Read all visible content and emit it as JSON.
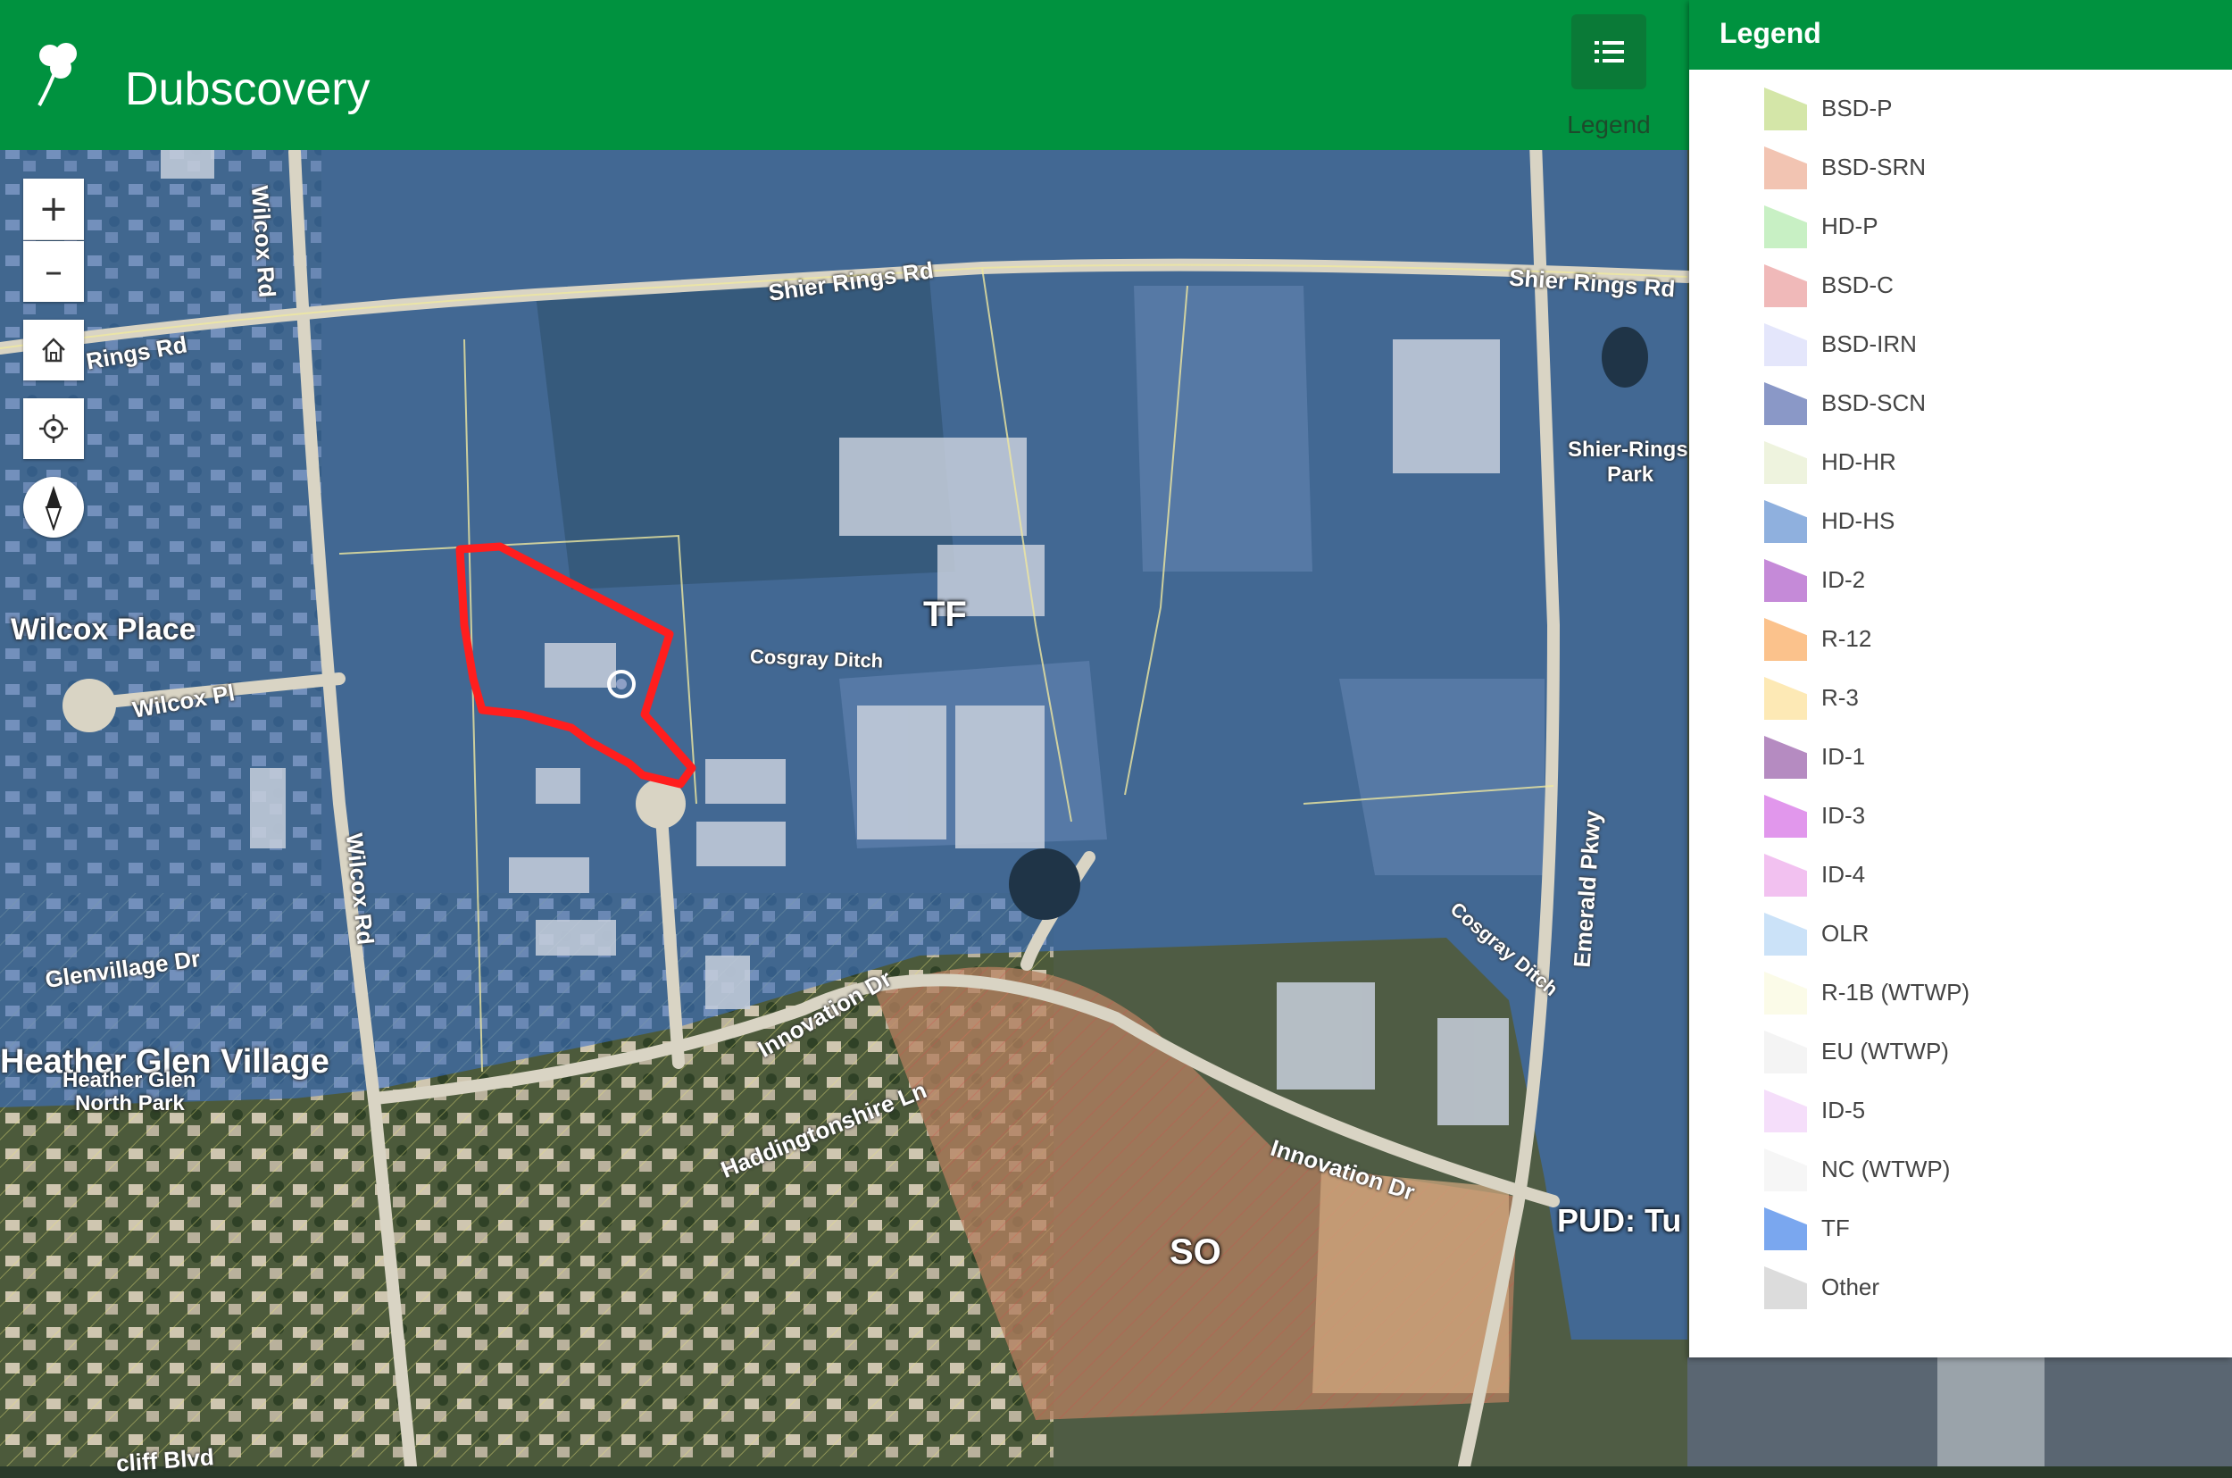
{
  "app": {
    "title": "Dubscovery"
  },
  "header": {
    "legend_button_label": "Legend"
  },
  "map_controls": {
    "zoom_in": "+",
    "zoom_out": "–"
  },
  "map_labels": {
    "roads": {
      "shier_rings_rd_1": "Shier Rings Rd",
      "shier_rings_rd_2": "Shier Rings Rd",
      "rings_rd": "Rings Rd",
      "wilcox_rd_north": "Wilcox Rd",
      "wilcox_rd_south": "Wilcox Rd",
      "wilcox_pl": "Wilcox Pl",
      "emerald_pkwy": "Emerald Pkwy",
      "innovation_dr_1": "Innovation Dr",
      "innovation_dr_2": "Innovation Dr",
      "cosgray_ditch_1": "Cosgray Ditch",
      "cosgray_ditch_2": "Cosgray Ditch",
      "glenvillage_dr": "Glenvillage Dr",
      "haddingtonshire_ln": "Haddingtonshire Ln",
      "cliff_blvd": "cliff Blvd"
    },
    "places": {
      "wilcox_place": "Wilcox Place",
      "heather_glen_village": "Heather Glen Village",
      "heather_glen_north_park_1": "Heather Glen",
      "heather_glen_north_park_2": "North Park",
      "shier_rings_park_1": "Shier-Rings",
      "shier_rings_park_2": "Park"
    },
    "zones": {
      "tf": "TF",
      "so": "SO",
      "pud": "PUD: Tu"
    }
  },
  "legend": {
    "title": "Legend",
    "items": [
      {
        "label": "BSD-P",
        "color": "#d4e6a8"
      },
      {
        "label": "BSD-SRN",
        "color": "#f2c4b2"
      },
      {
        "label": "HD-P",
        "color": "#c8f0c4"
      },
      {
        "label": "BSD-C",
        "color": "#f0b9b9"
      },
      {
        "label": "BSD-IRN",
        "color": "#e4e6fb"
      },
      {
        "label": "BSD-SCN",
        "color": "#8a98c7"
      },
      {
        "label": "HD-HR",
        "color": "#eef3de"
      },
      {
        "label": "HD-HS",
        "color": "#8fb0de"
      },
      {
        "label": "ID-2",
        "color": "#c58ad8"
      },
      {
        "label": "R-12",
        "color": "#fbc28c"
      },
      {
        "label": "R-3",
        "color": "#fde9b5"
      },
      {
        "label": "ID-1",
        "color": "#b58bc1"
      },
      {
        "label": "ID-3",
        "color": "#e197ec"
      },
      {
        "label": "ID-4",
        "color": "#f2c1f0"
      },
      {
        "label": "OLR",
        "color": "#cbe2f8"
      },
      {
        "label": "R-1B (WTWP)",
        "color": "#fbfbe8"
      },
      {
        "label": "EU (WTWP)",
        "color": "#f4f4f4"
      },
      {
        "label": "ID-5",
        "color": "#f5defa"
      },
      {
        "label": "NC (WTWP)",
        "color": "#f6f6f6"
      },
      {
        "label": "TF",
        "color": "#7aa7ef"
      },
      {
        "label": "Other",
        "color": "#dcdcdc"
      }
    ]
  }
}
